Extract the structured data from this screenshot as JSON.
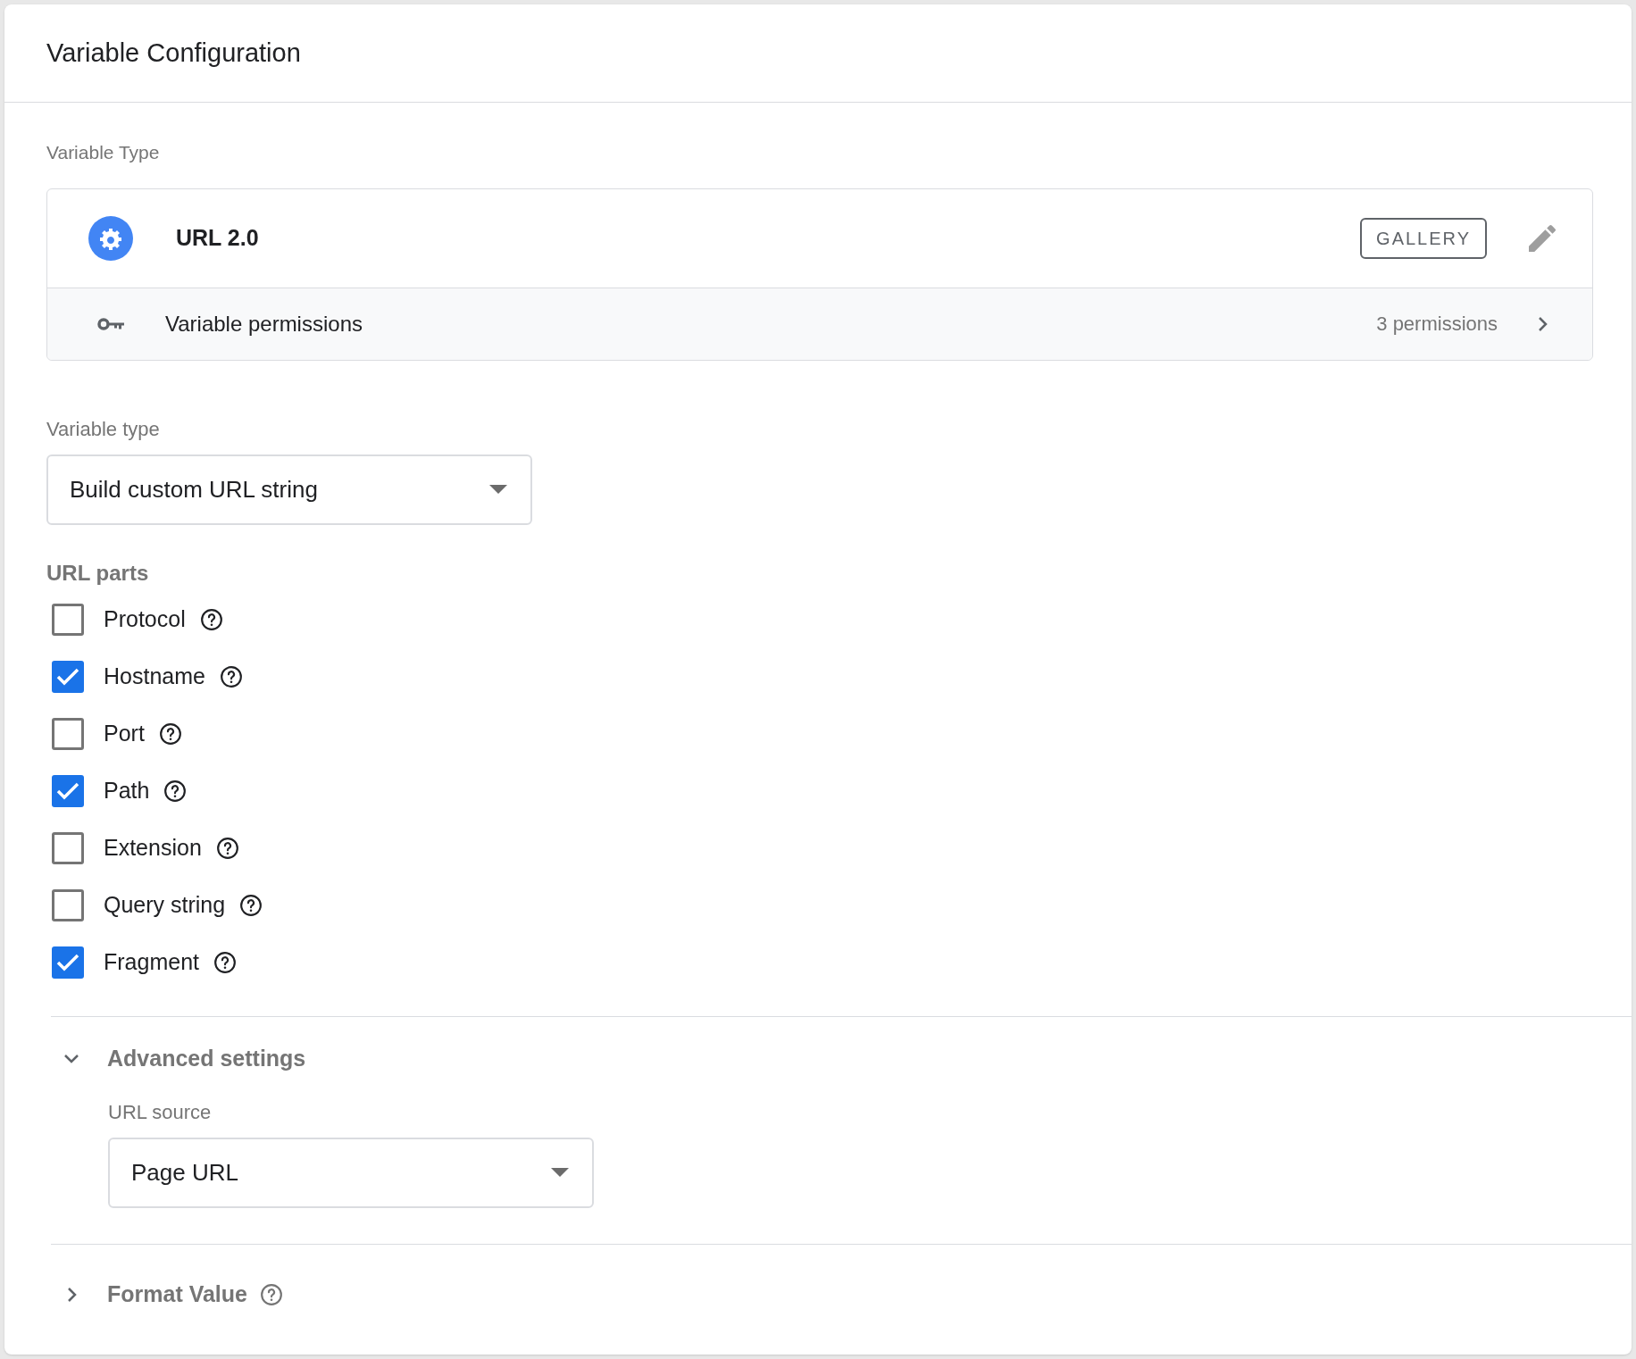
{
  "header": {
    "title": "Variable Configuration"
  },
  "variable_type_section": {
    "label": "Variable Type",
    "template_name": "URL 2.0",
    "gallery_button": "GALLERY",
    "permissions": {
      "label": "Variable permissions",
      "count": "3 permissions"
    }
  },
  "variable_type": {
    "label": "Variable type",
    "value": "Build custom URL string"
  },
  "url_parts": {
    "label": "URL parts",
    "items": [
      {
        "label": "Protocol",
        "checked": false
      },
      {
        "label": "Hostname",
        "checked": true
      },
      {
        "label": "Port",
        "checked": false
      },
      {
        "label": "Path",
        "checked": true
      },
      {
        "label": "Extension",
        "checked": false
      },
      {
        "label": "Query string",
        "checked": false
      },
      {
        "label": "Fragment",
        "checked": true
      }
    ]
  },
  "advanced_settings": {
    "title": "Advanced settings",
    "expanded": true,
    "url_source": {
      "label": "URL source",
      "value": "Page URL"
    }
  },
  "format_value": {
    "title": "Format Value",
    "expanded": false
  }
}
